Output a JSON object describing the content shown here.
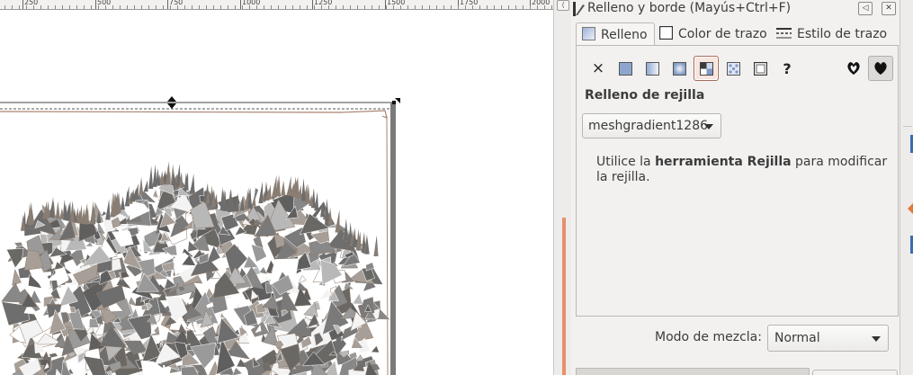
{
  "ruler": {
    "labels": [
      "250",
      "500",
      "750",
      "1000",
      "1250",
      "1500",
      "1750",
      "2000"
    ]
  },
  "dialog": {
    "title": "Relleno y borde (Mayús+Ctrl+F)"
  },
  "tabs": [
    {
      "label": "Relleno",
      "active": true
    },
    {
      "label": "Color de trazo",
      "active": false
    },
    {
      "label": "Estilo de trazo",
      "active": false
    }
  ],
  "fill_modes": {
    "unset_glyph": "×",
    "unknown_glyph": "?",
    "selected": "mesh-gradient"
  },
  "fill": {
    "heading": "Relleno de rejilla",
    "mesh_name": "meshgradient1286",
    "help_prefix": "Utilice la ",
    "help_bold": "herramienta Rejilla",
    "help_suffix": " para modificar la rejilla."
  },
  "blend": {
    "label": "Modo de mezcla:",
    "value": "Normal"
  },
  "colors": {
    "accent": "#a86b5a",
    "canvas_bg": "#ffffff",
    "panel_bg": "#f2f1f0",
    "orange_bar": "#e8906a"
  }
}
